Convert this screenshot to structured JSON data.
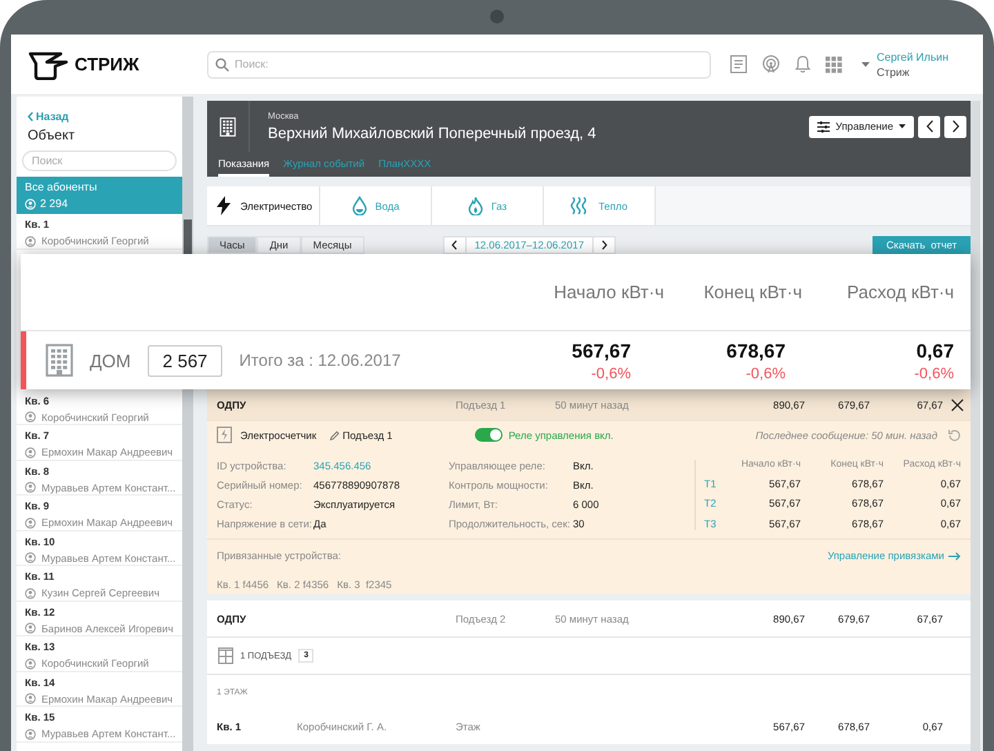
{
  "topbar": {
    "logo_text": "СТРИЖ",
    "search_placeholder": "Поиск:",
    "user_name": "Сергей Ильин",
    "user_org": "Стриж"
  },
  "sidebar": {
    "back": "Назад",
    "title": "Объект",
    "search_placeholder": "Поиск",
    "all": {
      "label": "Все абоненты",
      "count": "2 294",
      "selected": true
    },
    "items_top": [
      {
        "apt": "Кв. 1",
        "owner": "Коробчинский Георгий"
      }
    ],
    "items": [
      {
        "apt": "Кв. 6",
        "owner": "Коробчинский Георгий"
      },
      {
        "apt": "Кв. 7",
        "owner": "Ермохин Макар Андреевич"
      },
      {
        "apt": "Кв. 8",
        "owner": "Муравьев Артем Констант..."
      },
      {
        "apt": "Кв. 9",
        "owner": "Ермохин Макар Андреевич"
      },
      {
        "apt": "Кв. 10",
        "owner": "Муравьев Артем Констант..."
      },
      {
        "apt": "Кв. 11",
        "owner": "Кузин Сергей Сергеевич"
      },
      {
        "apt": "Кв. 12",
        "owner": "Баринов Алексей Игоревич"
      },
      {
        "apt": "Кв. 13",
        "owner": "Коробчинский Георгий"
      },
      {
        "apt": "Кв. 14",
        "owner": "Ермохин Макар Андреевич"
      },
      {
        "apt": "Кв. 15",
        "owner": "Муравьев Артем Констант..."
      }
    ]
  },
  "header": {
    "city": "Москва",
    "address": "Верхний Михайловский Поперечный проезд, 4",
    "manage": "Управление",
    "tabs": [
      {
        "label": "Показания",
        "selected": true
      },
      {
        "label": "Журнал событий",
        "selected": false
      },
      {
        "label": "ПланXXXX",
        "selected": false
      }
    ]
  },
  "resource_tabs": [
    {
      "label": "Электричество",
      "kind": "electricity",
      "selected": true
    },
    {
      "label": "Вода",
      "kind": "water",
      "selected": false
    },
    {
      "label": "Газ",
      "kind": "gas",
      "selected": false
    },
    {
      "label": "Тепло",
      "kind": "heat",
      "selected": false
    }
  ],
  "period_tabs": [
    {
      "label": "Часы",
      "selected": true
    },
    {
      "label": "Дни",
      "selected": false
    },
    {
      "label": "Месяцы",
      "selected": false
    }
  ],
  "date_range": "12.06.2017–12.06.2017",
  "download": "Скачать  отчет",
  "summary_card": {
    "columns": [
      "Начало кВт·ч",
      "Конец кВт·ч",
      "Расход кВт·ч"
    ],
    "label": "ДОМ",
    "count": "2 567",
    "total": "Итого за : 12.06.2017",
    "values": [
      {
        "value": "567,67",
        "change": "-0,6%"
      },
      {
        "value": "678,67",
        "change": "-0,6%"
      },
      {
        "value": "0,67",
        "change": "-0,6%"
      }
    ]
  },
  "meter": {
    "name": "ОДПУ",
    "entrance": "Подъезд 1",
    "time": "50 минут назад",
    "values": [
      "890,67",
      "679,67",
      "67,67"
    ],
    "expanded": true
  },
  "device": {
    "type": "Электросчетчик",
    "location": "Подъезд 1",
    "relay": {
      "label": "Реле управления вкл.",
      "on": true
    },
    "last_message": "Последнее сообщение: 50 мин. назад",
    "fields_left": [
      {
        "label": "ID устройства:",
        "value": "345.456.456",
        "kind": "link"
      },
      {
        "label": "Серийный номер:",
        "value": "456778890907878",
        "kind": "text"
      },
      {
        "label": "Статус:",
        "value": "Эксплуатируется",
        "kind": "text"
      },
      {
        "label": "Напряжение в сети:",
        "value": "Да",
        "kind": "text"
      }
    ],
    "fields_right": [
      {
        "label": "Управляющее реле:",
        "value": "Вкл.",
        "kind": "text"
      },
      {
        "label": "Контроль мощности:",
        "value": "Вкл.",
        "kind": "text"
      },
      {
        "label": "Лимит, Вт:",
        "value": "6 000",
        "kind": "text"
      },
      {
        "label": "Продолжительность, сек:",
        "value": "30",
        "kind": "text"
      }
    ],
    "tariff_columns": [
      "Начало кВт·ч",
      "Конец кВт·ч",
      "Расход кВт·ч"
    ],
    "tariffs": [
      {
        "name": "T1",
        "values": [
          "567,67",
          "678,67",
          "0,67"
        ]
      },
      {
        "name": "T2",
        "values": [
          "567,67",
          "678,67",
          "0,67"
        ]
      },
      {
        "name": "T3",
        "values": [
          "567,67",
          "678,67",
          "0,67"
        ]
      }
    ],
    "linked_label": "Привязанные устройства:",
    "linked_action": "Управление привязками",
    "linked": [
      "Кв. 1 f4456",
      "Кв. 2 f4356",
      "Кв. 3  f2345"
    ]
  },
  "entrance_block": {
    "meter": {
      "name": "ОДПУ",
      "entrance": "Подъезд 2",
      "time": "50 минут назад",
      "values": [
        "890,67",
        "679,67",
        "67,67"
      ],
      "expanded": false
    },
    "group": {
      "label": "1 ПОДЪЕЗД",
      "count": "3"
    },
    "floor": "1 ЭТАЖ",
    "rows": [
      {
        "apt": "Кв. 1",
        "owner": "Коробчинский Г. А.",
        "place": "Этаж",
        "values": [
          "567,67",
          "678,67",
          "0,67"
        ]
      }
    ]
  }
}
